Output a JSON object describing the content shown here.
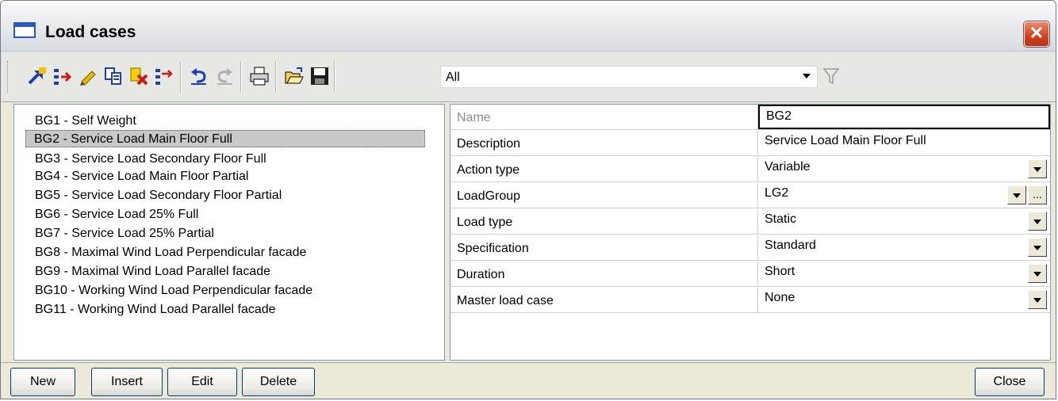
{
  "window": {
    "title": "Load cases",
    "close_glyph": "✕"
  },
  "toolbar": {
    "icons": [
      "new-icon",
      "insert-icon",
      "edit-icon",
      "copy-icon",
      "delete-icon",
      "move-icon",
      "undo-icon",
      "redo-icon",
      "print-icon",
      "open-icon",
      "save-icon",
      "filter-icon"
    ],
    "filter_value": "All"
  },
  "load_cases": [
    "BG1 - Self Weight",
    "BG2 - Service Load Main Floor Full",
    "BG3 - Service Load Secondary Floor Full",
    "BG4 - Service Load Main Floor Partial",
    "BG5 - Service Load Secondary Floor Partial",
    "BG6 - Service Load 25% Full",
    "BG7 - Service Load 25% Partial",
    "BG8 - Maximal Wind Load Perpendicular facade",
    "BG9 - Maximal Wind Load Parallel facade",
    "BG10 - Working Wind Load Perpendicular facade",
    "BG11 - Working Wind Load Parallel facade"
  ],
  "selected_index": 1,
  "properties": [
    {
      "name": "Name",
      "value": "BG2"
    },
    {
      "name": "Description",
      "value": "Service Load Main Floor Full"
    },
    {
      "name": "Action type",
      "value": "Variable"
    },
    {
      "name": "LoadGroup",
      "value": "LG2"
    },
    {
      "name": "Load type",
      "value": "Static"
    },
    {
      "name": "Specification",
      "value": "Standard"
    },
    {
      "name": "Duration",
      "value": "Short"
    },
    {
      "name": "Master load case",
      "value": "None"
    }
  ],
  "buttons": {
    "new": "New",
    "insert": "Insert",
    "edit": "Edit",
    "delete": "Delete",
    "close": "Close"
  },
  "colors": {
    "selection": "#c8c8c8",
    "close_button": "#cf4321",
    "title_icon": "#2a5ab8"
  }
}
